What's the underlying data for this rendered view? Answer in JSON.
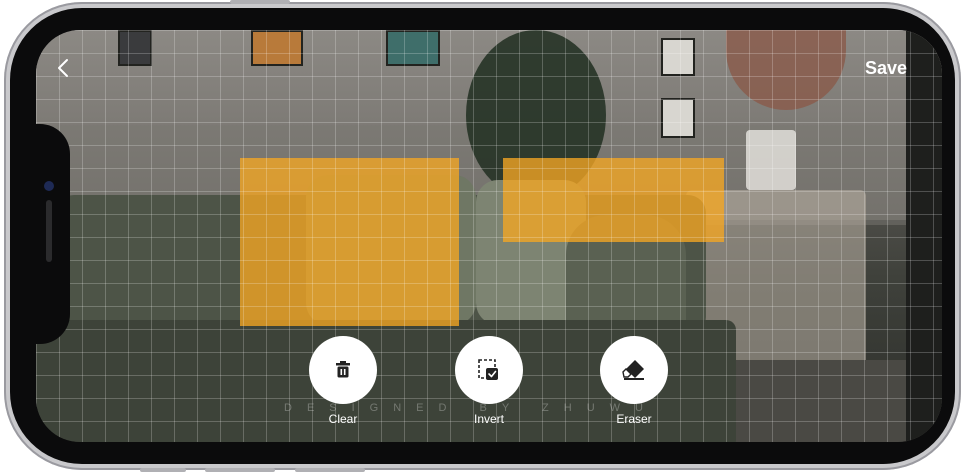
{
  "header": {
    "back_icon": "chevron-left-icon",
    "save_label": "Save"
  },
  "tools": [
    {
      "label": "Clear",
      "icon": "trash-icon"
    },
    {
      "label": "Invert",
      "icon": "invert-selection-icon"
    },
    {
      "label": "Eraser",
      "icon": "eraser-icon"
    }
  ],
  "watermark": "DESIGNED BY ZHUWU",
  "colors": {
    "mask": "#f5a623",
    "tool_background": "#ffffff",
    "icon": "#222222"
  }
}
